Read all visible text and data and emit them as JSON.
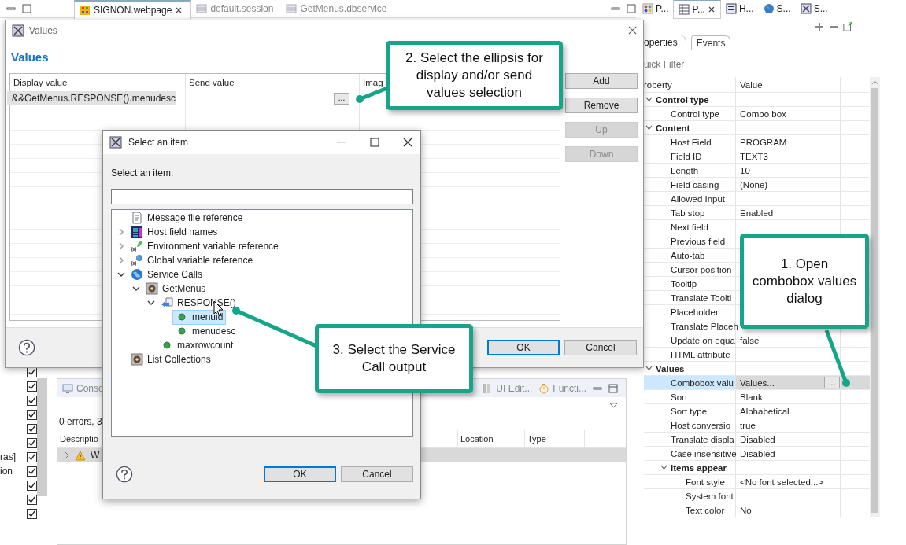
{
  "editor_tabs": [
    {
      "label": "SIGNON.webpage",
      "selected": true
    },
    {
      "label": "default.session",
      "selected": false
    },
    {
      "label": "GetMenus.dbservice",
      "selected": false
    }
  ],
  "view_tabs": [
    {
      "label": "P...",
      "selected": false
    },
    {
      "label": "P...",
      "selected": true
    },
    {
      "label": "H...",
      "selected": false
    },
    {
      "label": "S...",
      "selected": false
    },
    {
      "label": "S...",
      "selected": false
    }
  ],
  "checkboxes": [
    {
      "checked": true
    },
    {
      "checked": true
    },
    {
      "checked": true
    },
    {
      "checked": true
    },
    {
      "checked": true
    },
    {
      "checked": true
    },
    {
      "checked": true,
      "label": "ras]"
    },
    {
      "checked": true,
      "label": "ion"
    },
    {
      "checked": true
    },
    {
      "checked": true
    },
    {
      "checked": true
    }
  ],
  "console": {
    "tabs": [
      {
        "label": "Conso"
      },
      {
        "label": "UI Edit..."
      },
      {
        "label": "Functi..."
      }
    ],
    "summary": "0 errors, 3",
    "columns": [
      "Descriptio",
      "",
      "Location",
      "Type"
    ],
    "rows": [
      {
        "text": "W",
        "selected": true
      }
    ]
  },
  "properties": {
    "tabs": [
      {
        "label": "operties",
        "selected": true
      },
      {
        "label": "Events",
        "selected": false
      }
    ],
    "filter_placeholder": "uick Filter",
    "columns": [
      "roperty",
      "Value"
    ],
    "rows": [
      {
        "kind": "group",
        "name": "Control type",
        "expanded": true,
        "selected": false,
        "children": [
          {
            "kind": "property",
            "name": "Control type",
            "value": "Combo box",
            "selected": false
          }
        ]
      },
      {
        "kind": "group",
        "name": "Content",
        "expanded": true,
        "selected": false,
        "children": [
          {
            "kind": "property",
            "name": "Host Field",
            "value": "PROGRAM",
            "selected": false
          },
          {
            "kind": "property",
            "name": "Field ID",
            "value": "TEXT3",
            "selected": false
          },
          {
            "kind": "property",
            "name": "Length",
            "value": "10",
            "selected": false
          },
          {
            "kind": "property",
            "name": "Field casing",
            "value": "(None)",
            "selected": false
          },
          {
            "kind": "property",
            "name": "Allowed Input",
            "selected": false
          },
          {
            "kind": "property",
            "name": "Tab stop",
            "value": "Enabled",
            "selected": false
          },
          {
            "kind": "property",
            "name": "Next field",
            "selected": false
          },
          {
            "kind": "property",
            "name": "Previous field",
            "selected": false
          },
          {
            "kind": "property",
            "name": "Auto-tab",
            "selected": false
          },
          {
            "kind": "property",
            "name": "Cursor position",
            "selected": false
          },
          {
            "kind": "property",
            "name": "Tooltip",
            "selected": false
          },
          {
            "kind": "property",
            "name": "Translate Toolti",
            "selected": false
          },
          {
            "kind": "property",
            "name": "Placeholder",
            "selected": false
          },
          {
            "kind": "property",
            "name": "Translate Placeh",
            "selected": false
          },
          {
            "kind": "property",
            "name": "Update on equa",
            "value": "false",
            "selected": false
          },
          {
            "kind": "property",
            "name": "HTML attribute",
            "selected": false
          }
        ]
      },
      {
        "kind": "group",
        "name": "Values",
        "expanded": true,
        "selected": false,
        "children": [
          {
            "kind": "property",
            "name": "Combobox valu",
            "value": "Values...",
            "button": "...",
            "selected": true
          },
          {
            "kind": "property",
            "name": "Sort",
            "value": "Blank",
            "selected": false
          },
          {
            "kind": "property",
            "name": "Sort type",
            "value": "Alphabetical",
            "selected": false
          },
          {
            "kind": "property",
            "name": "Host conversio",
            "value": "true",
            "selected": false
          },
          {
            "kind": "property",
            "name": "Translate displa",
            "value": "Disabled",
            "selected": false
          },
          {
            "kind": "property",
            "name": "Case insensitive",
            "value": "Disabled",
            "selected": false
          },
          {
            "kind": "group",
            "name": "Items appear",
            "expanded": true,
            "selected": false,
            "children": [
              {
                "kind": "property",
                "name": "Font style",
                "value": "<No font selected...>",
                "selected": false
              },
              {
                "kind": "property",
                "name": "System font",
                "selected": false
              },
              {
                "kind": "property",
                "name": "Text color",
                "value": "No",
                "selected": false
              }
            ]
          }
        ]
      }
    ]
  },
  "values_dialog": {
    "title": "Values",
    "heading": "Values",
    "columns": [
      "Display value",
      "Send value",
      "Imag"
    ],
    "rows": [
      {
        "display": "&&GetMenus.RESPONSE().menudesc",
        "button": "...",
        "selected": true
      }
    ],
    "buttons": [
      {
        "label": "Add",
        "disabled": false
      },
      {
        "label": "Remove",
        "disabled": false
      },
      {
        "label": "Up",
        "disabled": true
      },
      {
        "label": "Down",
        "disabled": true
      }
    ],
    "ok": "OK",
    "cancel": "Cancel"
  },
  "select_dialog": {
    "title": "Select an item",
    "prompt": "Select an item.",
    "tree": [
      {
        "label": "Message file reference",
        "kind": "document",
        "selected": false
      },
      {
        "label": "Host field names",
        "kind": "host",
        "expanded": false,
        "selected": false
      },
      {
        "label": "Environment variable reference",
        "kind": "environment",
        "expanded": false,
        "selected": false
      },
      {
        "label": "Global variable reference",
        "kind": "global",
        "expanded": false,
        "selected": false
      },
      {
        "label": "Service Calls",
        "kind": "services",
        "expanded": true,
        "selected": false,
        "children": [
          {
            "label": "GetMenus",
            "kind": "operation",
            "expanded": true,
            "selected": false,
            "children": [
              {
                "label": "RESPONSE()",
                "kind": "response",
                "expanded": true,
                "selected": false,
                "children": [
                  {
                    "label": "menuid",
                    "kind": "field",
                    "selected": true
                  },
                  {
                    "label": "menudesc",
                    "kind": "field",
                    "selected": false
                  }
                ]
              },
              {
                "label": "maxrowcount",
                "kind": "field",
                "selected": false
              }
            ]
          }
        ]
      },
      {
        "label": "List Collections",
        "kind": "collection",
        "selected": false
      }
    ],
    "ok": "OK",
    "cancel": "Cancel"
  },
  "callouts": [
    {
      "text": "2. Select the ellipsis for display and/or send values selection"
    },
    {
      "text": "1. Open combobox values dialog"
    },
    {
      "text": "3. Select the Service Call output"
    }
  ]
}
